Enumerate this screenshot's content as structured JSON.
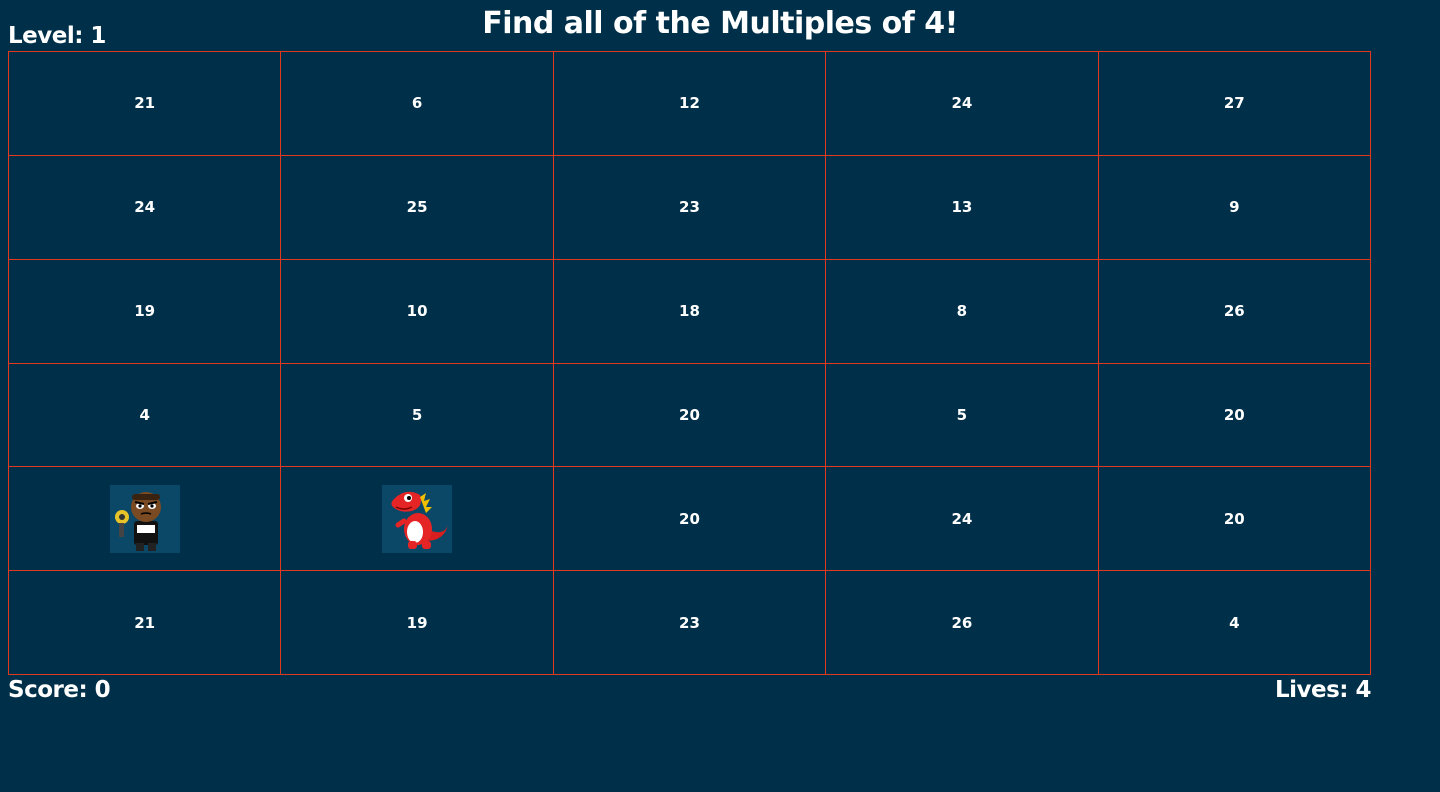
{
  "header": {
    "title": "Find all of the Multiples of 4!",
    "level": "Level: 1"
  },
  "board": {
    "rows": [
      [
        "21",
        "6",
        "12",
        "24",
        "27"
      ],
      [
        "24",
        "25",
        "23",
        "13",
        "9"
      ],
      [
        "19",
        "10",
        "18",
        "8",
        "26"
      ],
      [
        "4",
        "5",
        "20",
        "5",
        "20"
      ],
      [
        "",
        "",
        "20",
        "24",
        "20"
      ],
      [
        "21",
        "19",
        "23",
        "26",
        "4"
      ]
    ],
    "sprites": [
      {
        "row": 4,
        "col": 0,
        "name": "player-character-icon"
      },
      {
        "row": 4,
        "col": 1,
        "name": "red-dinosaur-enemy-icon"
      }
    ]
  },
  "footer": {
    "score": "Score: 0",
    "lives": "Lives: 4"
  },
  "colors": {
    "background": "#003049",
    "grid_border": "#e03a1e",
    "text": "#ffffff"
  }
}
